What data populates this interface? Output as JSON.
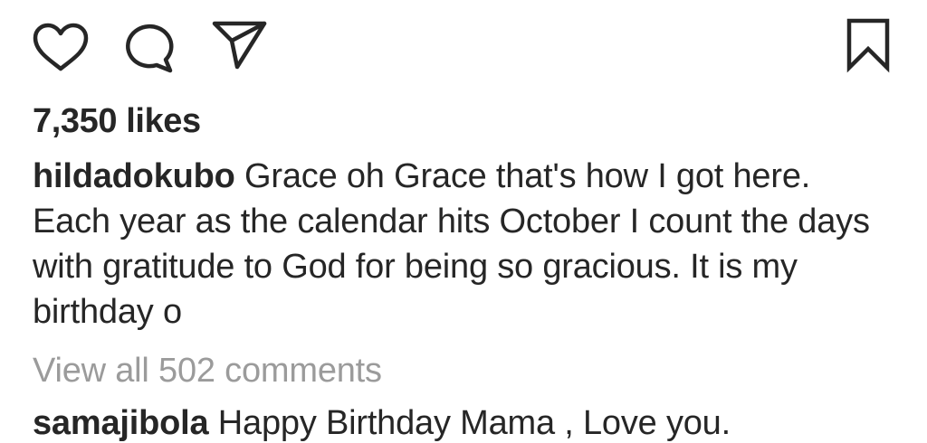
{
  "actions": {
    "like_icon": "heart-outline",
    "comment_icon": "speech-bubble-outline",
    "share_icon": "paper-plane-outline",
    "save_icon": "bookmark-outline"
  },
  "post": {
    "likes_text": "7,350 likes",
    "caption": {
      "username": "hildadokubo",
      "text": "Grace oh Grace that's how I got here. Each year as the calendar hits October I count the days with gratitude to God for being so gracious. It is my birthday o"
    },
    "view_all_comments": "View all 502 comments",
    "comments": [
      {
        "username": "samajibola",
        "text": "Happy Birthday Mama , Love you."
      }
    ]
  },
  "colors": {
    "text": "#262626",
    "muted": "#9b9b9b",
    "background": "#ffffff"
  }
}
